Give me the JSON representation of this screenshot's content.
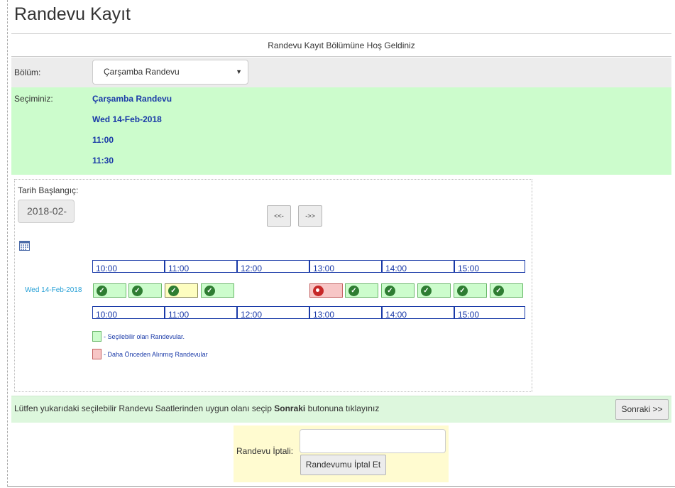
{
  "page": {
    "title": "Randevu Kayıt",
    "welcome": "Randevu Kayıt Bölümüne Hoş Geldiniz"
  },
  "bolum": {
    "label": "Bölüm:",
    "selected": "Çarşamba Randevu"
  },
  "secim": {
    "label": "Seçiminiz:",
    "department": "Çarşamba Randevu",
    "date": "Wed 14-Feb-2018",
    "start": "11:00",
    "end": "11:30"
  },
  "calendar": {
    "date_label": "Tarih Başlangıç:",
    "date_value": "2018-02-",
    "prev_label": "<<-",
    "next_label": "->>",
    "hours_top": [
      "10:00",
      "11:00",
      "12:00",
      "13:00",
      "14:00",
      "15:00"
    ],
    "hours_bottom": [
      "10:00",
      "11:00",
      "12:00",
      "13:00",
      "14:00",
      "15:00"
    ],
    "row_date": "Wed 14-Feb-2018",
    "slots": [
      {
        "status": "available"
      },
      {
        "status": "available"
      },
      {
        "status": "selected"
      },
      {
        "status": "available"
      },
      {
        "status": "taken"
      },
      {
        "status": "available"
      },
      {
        "status": "available"
      },
      {
        "status": "available"
      },
      {
        "status": "available"
      },
      {
        "status": "available"
      }
    ],
    "legend": {
      "available": "- Seçilebilir olan Randevular.",
      "taken": "- Daha Önceden Alınmış Randevular"
    }
  },
  "footer": {
    "text_before": "Lütfen yukarıdaki seçilebilir Randevu Saatlerinden uygun olanı seçip ",
    "text_bold": "Sonraki",
    "text_after": " butonuna tıklayınız",
    "next_label": "Sonraki >>"
  },
  "cancel": {
    "label": "Randevu İptali:",
    "input_value": "",
    "button_label": "Randevumu İptal Et"
  },
  "colors": {
    "available": "#ccfccc",
    "selected": "#fdfdc0",
    "taken": "#f7c6c6",
    "link": "#1a3aa8"
  }
}
